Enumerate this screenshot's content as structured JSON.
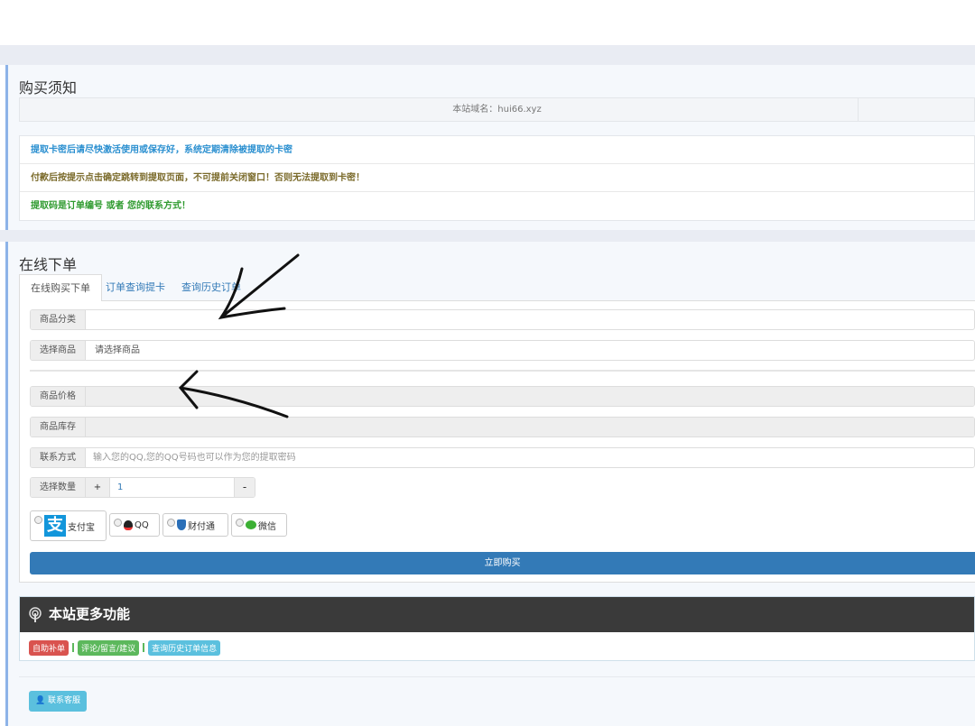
{
  "notice": {
    "title": "购买须知",
    "domain": "本站域名：hui66.xyz",
    "lines": [
      {
        "text": "提取卡密后请尽快激活使用或保存好，系统定期清除被提取的卡密",
        "color": "#2a8fd0"
      },
      {
        "text": "付款后按提示点击确定跳转到提取页面，不可提前关闭窗口！否则无法提取到卡密！",
        "color": "#7a6a2a"
      },
      {
        "text": "提取码是订单编号 或者 您的联系方式！",
        "color": "#2e9a2e"
      }
    ]
  },
  "order": {
    "title": "在线下单",
    "tabs": [
      "在线购买下单",
      "订单查询提卡",
      "查询历史订单"
    ],
    "category_label": "商品分类",
    "category_value": "",
    "product_label": "选择商品",
    "product_value": "请选择商品",
    "price_label": "商品价格",
    "stock_label": "商品库存",
    "contact_label": "联系方式",
    "contact_placeholder": "输入您的QQ,您的QQ号码也可以作为您的提取密码",
    "qty_label": "选择数量",
    "qty_plus": "+",
    "qty_value": "1",
    "qty_minus": "-",
    "payments": [
      "支付宝",
      "QQ",
      "财付通",
      "微信"
    ],
    "buy_button": "立即购买"
  },
  "more": {
    "title": "本站更多功能",
    "links": [
      "自助补单",
      "评论/留言/建议",
      "查询历史订单信息"
    ],
    "contact_button": "联系客服"
  },
  "colors": {
    "primary": "#337ab7",
    "danger": "#d9534f",
    "success": "#5cb85c",
    "info": "#5bc0de"
  }
}
